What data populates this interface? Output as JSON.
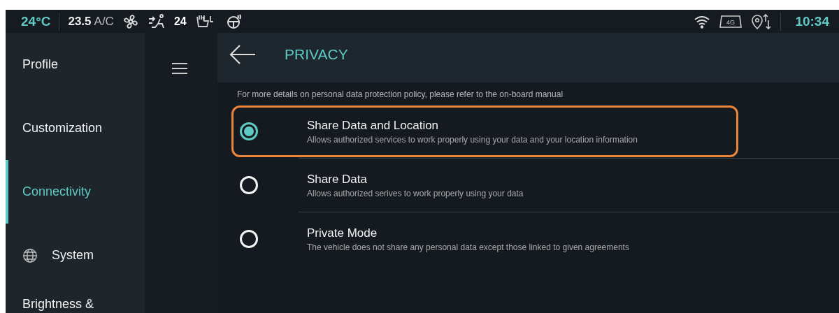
{
  "status_bar": {
    "temperature": "24°C",
    "ac_value": "23.5",
    "ac_label": "A/C",
    "fan_level": "24",
    "network": "4G",
    "time": "10:34"
  },
  "sidebar": {
    "items": [
      {
        "label": "Profile",
        "selected": false,
        "kind": "plain"
      },
      {
        "label": "Customization",
        "selected": false,
        "kind": "plain"
      },
      {
        "label": "Connectivity",
        "selected": true,
        "kind": "plain"
      },
      {
        "label": "System",
        "selected": false,
        "kind": "iconed"
      },
      {
        "label": "Brightness &",
        "selected": false,
        "kind": "plain"
      }
    ]
  },
  "header": {
    "title": "PRIVACY"
  },
  "notice": "For more details on personal data protection policy, please refer to the on-board manual",
  "options": [
    {
      "title": "Share Data and Location",
      "description": "Allows authorized services to work properly using your data and your location information",
      "selected": true,
      "highlighted": true
    },
    {
      "title": "Share Data",
      "description": "Allows authorized serives to work properly using your data",
      "selected": false,
      "highlighted": false
    },
    {
      "title": "Private Mode",
      "description": "The vehicle does not share any personal data except those linked to given agreements",
      "selected": false,
      "highlighted": false
    }
  ]
}
